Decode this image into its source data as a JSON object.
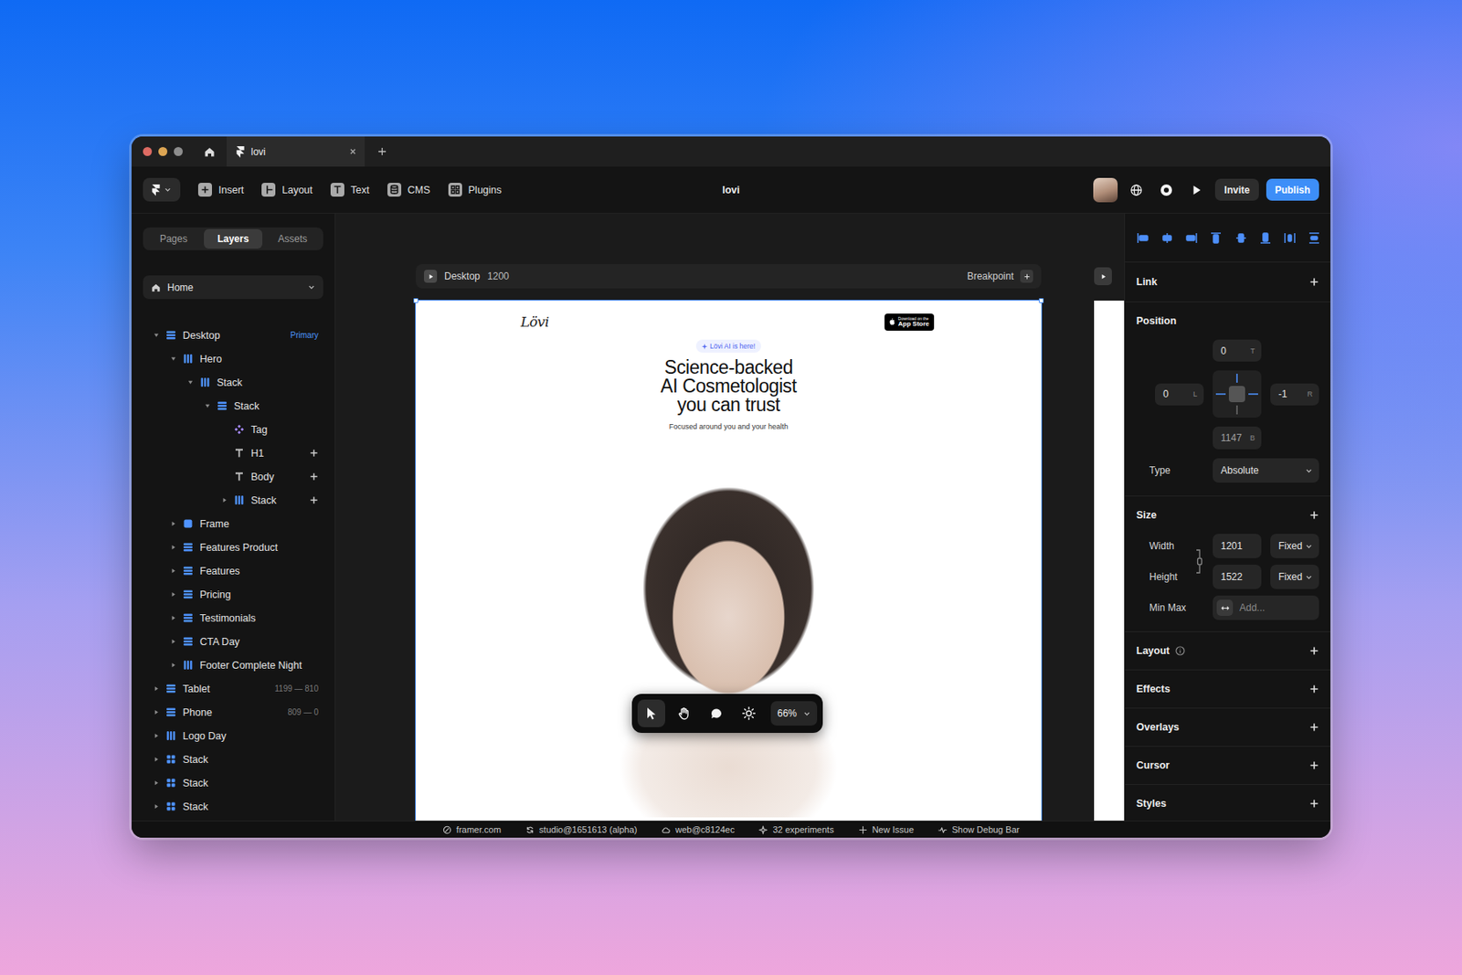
{
  "titlebar": {
    "tabs": [
      {
        "label": "lovi",
        "selected": true
      }
    ]
  },
  "toolbar": {
    "items": [
      {
        "kind": "insert",
        "label": "Insert"
      },
      {
        "kind": "layout",
        "label": "Layout"
      },
      {
        "kind": "text",
        "label": "Text"
      },
      {
        "kind": "cms",
        "label": "CMS"
      },
      {
        "kind": "plugins",
        "label": "Plugins"
      }
    ],
    "project": "lovi",
    "invite": "Invite",
    "publish": "Publish"
  },
  "left_panel": {
    "tabs": [
      {
        "label": "Pages",
        "selected": false
      },
      {
        "label": "Layers",
        "selected": true
      },
      {
        "label": "Assets",
        "selected": false
      }
    ],
    "page": "Home",
    "layers": [
      {
        "name": "Desktop",
        "level": 0,
        "kind": "stack-v",
        "has_children": true,
        "expanded": true,
        "add": false,
        "meta": "Primary",
        "meta_color": "#4c97ff"
      },
      {
        "name": "Hero",
        "level": 1,
        "kind": "stack-h",
        "has_children": true,
        "expanded": true,
        "add": false
      },
      {
        "name": "Stack",
        "level": 2,
        "kind": "stack-h",
        "has_children": true,
        "expanded": true,
        "add": false
      },
      {
        "name": "Stack",
        "level": 3,
        "kind": "stack-v",
        "has_children": true,
        "expanded": true,
        "add": false
      },
      {
        "name": "Tag",
        "level": 4,
        "kind": "component",
        "has_children": false,
        "expanded": false,
        "add": false
      },
      {
        "name": "H1",
        "level": 4,
        "kind": "text",
        "has_children": false,
        "expanded": false,
        "add": true
      },
      {
        "name": "Body",
        "level": 4,
        "kind": "text",
        "has_children": false,
        "expanded": false,
        "add": true
      },
      {
        "name": "Stack",
        "level": 4,
        "kind": "stack-h",
        "has_children": true,
        "expanded": false,
        "add": true
      },
      {
        "name": "Frame",
        "level": 1,
        "kind": "frame",
        "has_children": true,
        "expanded": false,
        "add": false
      },
      {
        "name": "Features Product",
        "level": 1,
        "kind": "stack-v",
        "has_children": true,
        "expanded": false,
        "add": false
      },
      {
        "name": "Features",
        "level": 1,
        "kind": "stack-v",
        "has_children": true,
        "expanded": false,
        "add": false
      },
      {
        "name": "Pricing",
        "level": 1,
        "kind": "stack-v",
        "has_children": true,
        "expanded": false,
        "add": false
      },
      {
        "name": "Testimonials",
        "level": 1,
        "kind": "stack-v",
        "has_children": true,
        "expanded": false,
        "add": false
      },
      {
        "name": "CTA Day",
        "level": 1,
        "kind": "stack-v",
        "has_children": true,
        "expanded": false,
        "add": false
      },
      {
        "name": "Footer Complete Night",
        "level": 1,
        "kind": "stack-h",
        "has_children": true,
        "expanded": false,
        "add": false
      },
      {
        "name": "Tablet",
        "level": 0,
        "kind": "stack-v",
        "has_children": true,
        "expanded": false,
        "add": false,
        "meta": "1199 — 810",
        "meta_color": "#7a7a7a"
      },
      {
        "name": "Phone",
        "level": 0,
        "kind": "stack-v",
        "has_children": true,
        "expanded": false,
        "add": false,
        "meta": "809 — 0",
        "meta_color": "#7a7a7a"
      },
      {
        "name": "Logo Day",
        "level": 0,
        "kind": "stack-h",
        "has_children": true,
        "expanded": false,
        "add": false
      },
      {
        "name": "Stack",
        "level": 0,
        "kind": "grid",
        "has_children": true,
        "expanded": false,
        "add": false
      },
      {
        "name": "Stack",
        "level": 0,
        "kind": "grid",
        "has_children": true,
        "expanded": false,
        "add": false
      },
      {
        "name": "Stack",
        "level": 0,
        "kind": "grid",
        "has_children": true,
        "expanded": false,
        "add": false
      }
    ]
  },
  "canvas": {
    "breakpoint": {
      "name": "Desktop",
      "width": "1200",
      "action": "Breakpoint"
    },
    "page": {
      "logo": "Lövi",
      "badge_small": "Download on the",
      "badge_large": "App Store",
      "tag": "Lövi AI is here!",
      "headline": [
        "Science-backed",
        "AI Cosmetologist",
        "you can trust"
      ],
      "subtitle": "Focused around you and your health"
    },
    "tools": [
      {
        "kind": "select",
        "selected": true
      },
      {
        "kind": "hand",
        "selected": false
      },
      {
        "kind": "comment",
        "selected": false
      },
      {
        "kind": "theme",
        "selected": false
      }
    ],
    "zoom": "66%"
  },
  "right_panel": {
    "link": "Link",
    "position": {
      "label": "Position",
      "pins": {
        "top": {
          "value": "0",
          "unit": "T",
          "pinned": true
        },
        "left": {
          "value": "0",
          "unit": "L",
          "pinned": true
        },
        "right": {
          "value": "-1",
          "unit": "R",
          "pinned": true
        },
        "bottom": {
          "value": "1147",
          "unit": "B",
          "pinned": false
        }
      },
      "type_label": "Type",
      "type": "Absolute"
    },
    "size": {
      "label": "Size",
      "rows": [
        {
          "label": "Width",
          "value": "1201",
          "mode": "Fixed"
        },
        {
          "label": "Height",
          "value": "1522",
          "mode": "Fixed"
        }
      ],
      "minmax_label": "Min Max",
      "minmax_placeholder": "Add..."
    },
    "sections": [
      {
        "label": "Layout",
        "info": true
      },
      {
        "label": "Effects",
        "info": false
      },
      {
        "label": "Overlays",
        "info": false
      },
      {
        "label": "Cursor",
        "info": false
      },
      {
        "label": "Styles",
        "info": false
      }
    ]
  },
  "status_bar": [
    {
      "kind": "framer",
      "label": "framer.com"
    },
    {
      "kind": "branch",
      "label": "studio@1651613 (alpha)"
    },
    {
      "kind": "cloud",
      "label": "web@c8124ec"
    },
    {
      "kind": "sparkle",
      "label": "32 experiments"
    },
    {
      "kind": "plus",
      "label": "New Issue"
    },
    {
      "kind": "pulse",
      "label": "Show Debug Bar"
    }
  ]
}
